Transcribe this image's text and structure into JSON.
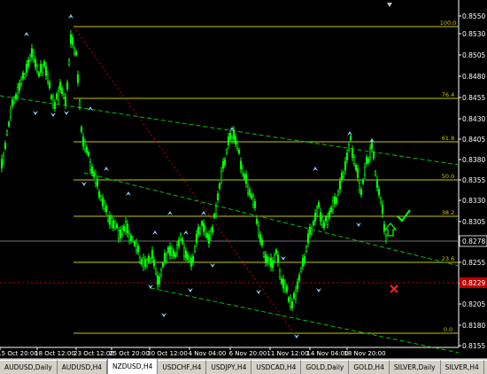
{
  "chart": {
    "symbol": "NZDUSD",
    "timeframe": "H4",
    "colors": {
      "background": "#000000",
      "candle_up": "#00ff00",
      "candle_down": "#00ff00",
      "fibo_line": "#c8c800",
      "fibo_label": "#c8c800",
      "channel": "#00c000",
      "red_dotted": "#c00000",
      "arrow_marker": "#8ec8ff",
      "axis_text": "#ffffff",
      "grid": "#ffffff"
    },
    "price_labels": [
      "0.8550",
      "0.8530",
      "0.8505",
      "0.8480",
      "0.8455",
      "0.8430",
      "0.8405",
      "0.8380",
      "0.8355",
      "0.8330",
      "0.8305",
      "0.8255",
      "0.8230",
      "0.8205",
      "0.8180",
      "0.8155"
    ],
    "current_price": "0.8278",
    "red_price": "0.8229",
    "fib_levels": [
      {
        "label": "100.0"
      },
      {
        "label": "76.4"
      },
      {
        "label": "61.8"
      },
      {
        "label": "50.0"
      },
      {
        "label": "38.2"
      },
      {
        "label": "23.6"
      },
      {
        "label": "0.0"
      }
    ],
    "time_labels": [
      "15 Oct 20:00",
      "18 Oct 12:00",
      "23 Oct 12:00",
      "25 Oct 20:00",
      "30 Oct 12:00",
      "4 Nov 04:00",
      "6 Nov 20:00",
      "11 Nov 12:00",
      "14 Nov 04:00",
      "18 Nov 20:00"
    ]
  },
  "tabs": [
    {
      "label": "AUDUSD,Daily",
      "active": false
    },
    {
      "label": "AUDUSD,H4",
      "active": false
    },
    {
      "label": "NZDUSD,H4",
      "active": true
    },
    {
      "label": "USDCHF,H4",
      "active": false
    },
    {
      "label": "USDJPY,H4",
      "active": false
    },
    {
      "label": "USDCAD,H4",
      "active": false
    },
    {
      "label": "GOLD,Daily",
      "active": false
    },
    {
      "label": "GOLD,H4",
      "active": false
    },
    {
      "label": "SILVER,Daily",
      "active": false
    },
    {
      "label": "SILVER,H4",
      "active": false
    },
    {
      "label": "C",
      "active": false
    }
  ],
  "tab_scroll": {
    "left": "◀",
    "right": "▶"
  }
}
